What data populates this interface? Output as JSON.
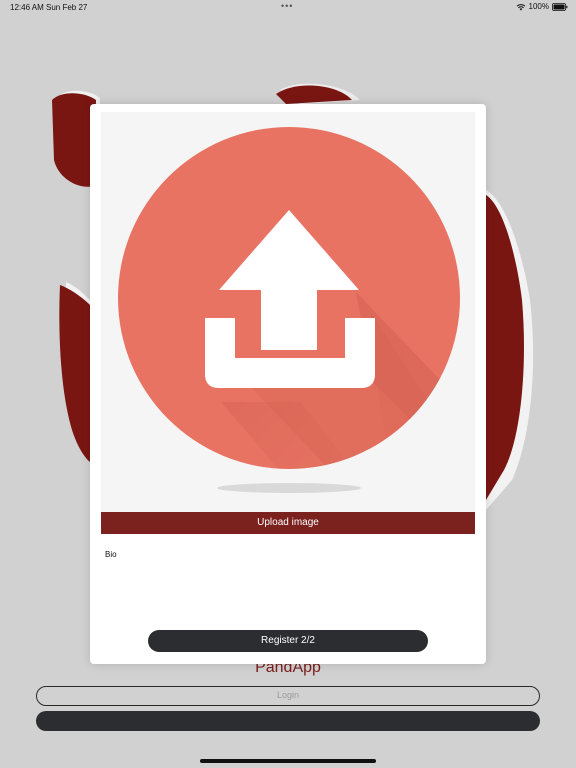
{
  "status_bar": {
    "time": "12:46 AM",
    "date": "Sun Feb 27",
    "battery": "100%"
  },
  "modal": {
    "upload_icon": "upload-tray-icon",
    "upload_button_label": "Upload image",
    "bio_placeholder": "Bio",
    "register_button_label": "Register 2/2"
  },
  "background": {
    "app_title": "PandApp",
    "login_label": "Login"
  },
  "colors": {
    "brand_red": "#7b211e",
    "upload_circle": "#e87363",
    "dark_button": "#2b2d31"
  }
}
